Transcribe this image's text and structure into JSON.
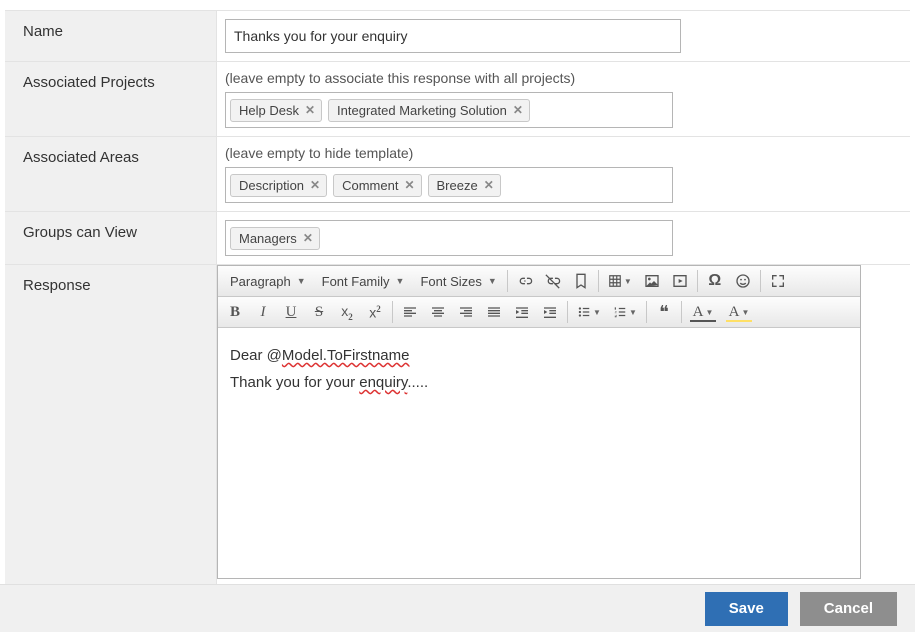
{
  "labels": {
    "name": "Name",
    "projects": "Associated Projects",
    "areas": "Associated Areas",
    "groups": "Groups can View",
    "response": "Response"
  },
  "nameValue": "Thanks you for your enquiry",
  "help": {
    "projects": "(leave empty to associate this response with all projects)",
    "areas": "(leave empty to hide template)"
  },
  "tags": {
    "projects": [
      "Help Desk",
      "Integrated Marketing Solution"
    ],
    "areas": [
      "Description",
      "Comment",
      "Breeze"
    ],
    "groups": [
      "Managers"
    ]
  },
  "editor": {
    "selects": {
      "block": "Paragraph",
      "font": "Font Family",
      "size": "Font Sizes"
    },
    "greetPrefix": "Dear @",
    "greetToken": "Model.ToFirstname",
    "line2a": "Thank you for your ",
    "line2err": "enquiry",
    "line2b": "....."
  },
  "footer": {
    "save": "Save",
    "cancel": "Cancel"
  }
}
